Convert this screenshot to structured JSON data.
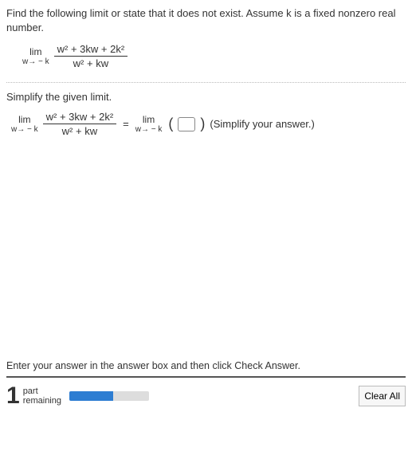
{
  "instruction": "Find the following limit or state that it does not exist. Assume k is a fixed nonzero real number.",
  "limit1": {
    "lim": "lim",
    "approach": "w→ − k",
    "numerator": "w² + 3kw + 2k²",
    "denominator": "w² + kw"
  },
  "simplify_label": "Simplify the given limit.",
  "eq": {
    "left": {
      "lim": "lim",
      "approach": "w→ − k",
      "numerator": "w² + 3kw + 2k²",
      "denominator": "w² + kw"
    },
    "equals": "=",
    "right": {
      "lim": "lim",
      "approach": "w→ − k"
    },
    "hint": "(Simplify your answer.)"
  },
  "footer_instruction": "Enter your answer in the answer box and then click Check Answer.",
  "footer": {
    "count": "1",
    "line1": "part",
    "line2": "remaining",
    "clear": "Clear All"
  }
}
